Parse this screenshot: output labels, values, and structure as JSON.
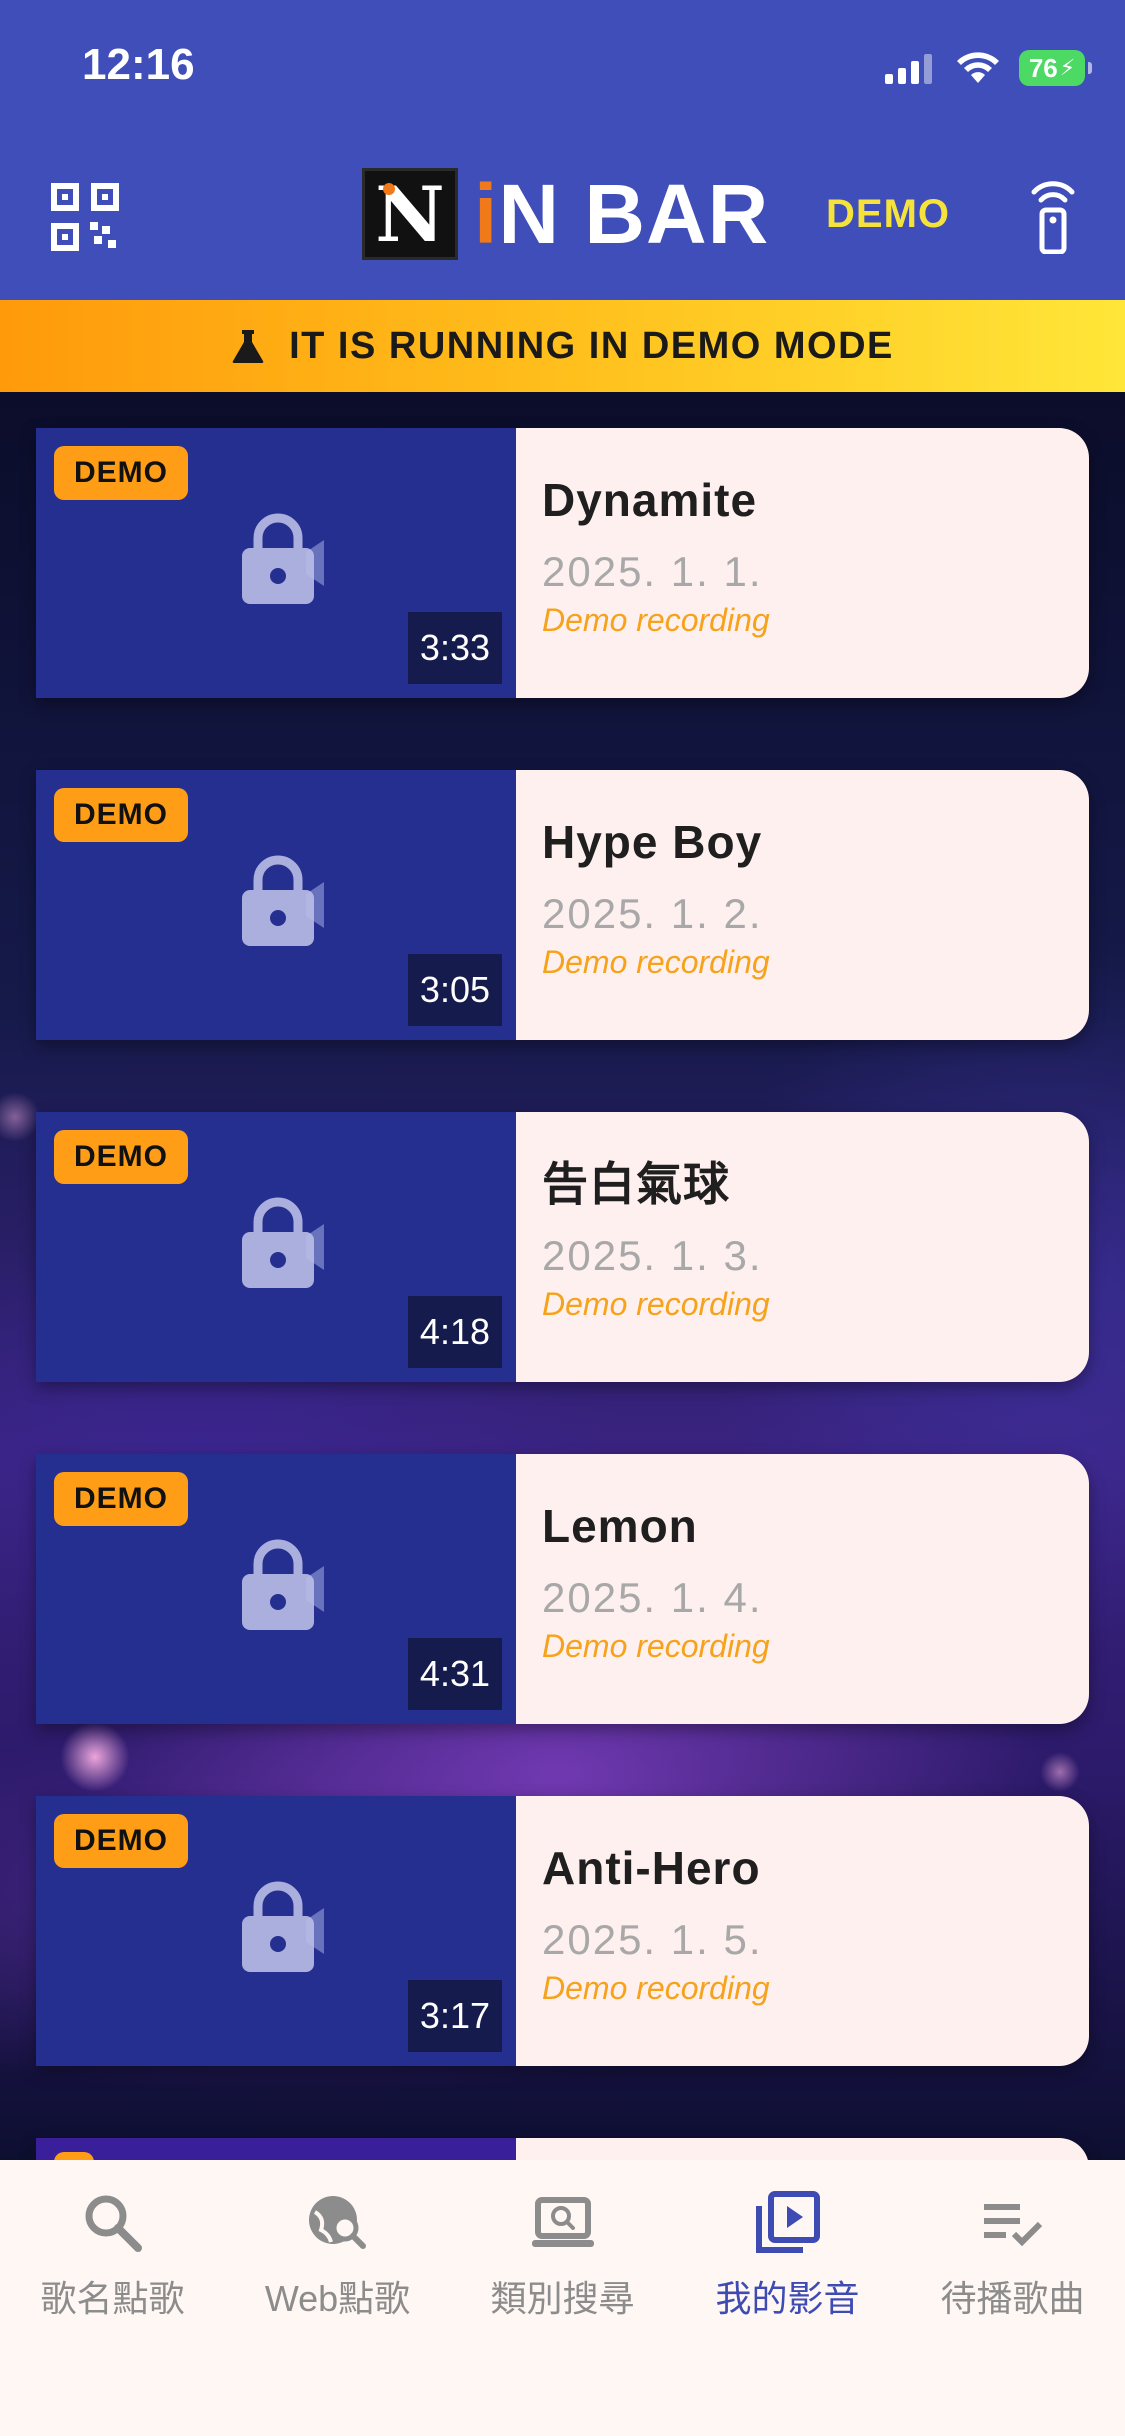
{
  "status_bar": {
    "time": "12:16",
    "battery": "76"
  },
  "header": {
    "logo_letter": "N",
    "logo_text_i": "i",
    "logo_text_rest": "N BAR",
    "demo_label": "DEMO",
    "qr_icon": "qr-code-icon",
    "remote_icon": "remote-control-icon"
  },
  "banner": {
    "text": "IT IS RUNNING IN DEMO MODE",
    "icon": "flask-icon"
  },
  "songs": [
    {
      "badge": "DEMO",
      "duration": "3:33",
      "title": "Dynamite",
      "date": "2025. 1. 1.",
      "note": "Demo recording"
    },
    {
      "badge": "DEMO",
      "duration": "3:05",
      "title": "Hype Boy",
      "date": "2025. 1. 2.",
      "note": "Demo recording"
    },
    {
      "badge": "DEMO",
      "duration": "4:18",
      "title": "告白氣球",
      "date": "2025. 1. 3.",
      "note": "Demo recording"
    },
    {
      "badge": "DEMO",
      "duration": "4:31",
      "title": "Lemon",
      "date": "2025. 1. 4.",
      "note": "Demo recording"
    },
    {
      "badge": "DEMO",
      "duration": "3:17",
      "title": "Anti-Hero",
      "date": "2025. 1. 5.",
      "note": "Demo recording"
    }
  ],
  "nav": [
    {
      "label": "歌名點歌",
      "icon": "search-icon",
      "active": false
    },
    {
      "label": "Web點歌",
      "icon": "web-search-icon",
      "active": false
    },
    {
      "label": "類別搜尋",
      "icon": "category-search-icon",
      "active": false
    },
    {
      "label": "我的影音",
      "icon": "video-library-icon",
      "active": true
    },
    {
      "label": "待播歌曲",
      "icon": "playlist-check-icon",
      "active": false
    }
  ],
  "colors": {
    "header_bg": "#3f4eb8",
    "accent_yellow": "#f5e23a",
    "banner_orange": "#ff9a0b",
    "badge_orange": "#ff9e16",
    "active_nav": "#3e4bb3",
    "note_orange": "#f6a21a"
  }
}
